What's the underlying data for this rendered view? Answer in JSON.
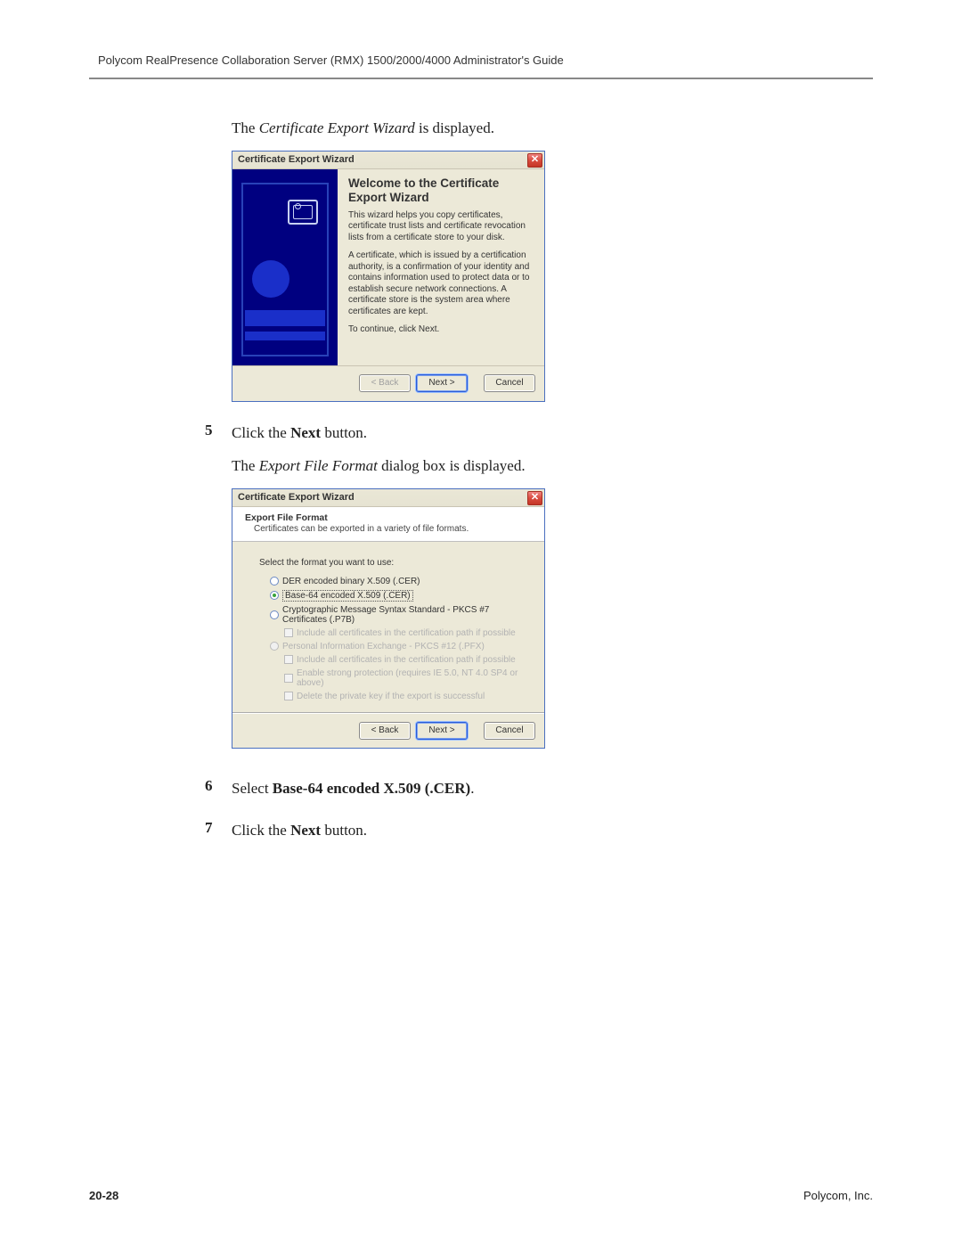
{
  "doc_header": "Polycom RealPresence Collaboration Server (RMX) 1500/2000/4000 Administrator's Guide",
  "intro_text_pre": "The ",
  "intro_text_italic": "Certificate Export Wizard",
  "intro_text_post": " is displayed.",
  "dialog1": {
    "title": "Certificate Export Wizard",
    "heading": "Welcome to the Certificate Export Wizard",
    "p1": "This wizard helps you copy certificates, certificate trust lists and certificate revocation lists from a certificate store to your disk.",
    "p2": "A certificate, which is issued by a certification authority, is a confirmation of your identity and contains information used to protect data or to establish secure network connections. A certificate store is the system area where certificates are kept.",
    "p3": "To continue, click Next.",
    "back": "< Back",
    "next": "Next >",
    "cancel": "Cancel"
  },
  "step5_num": "5",
  "step5_pre": "Click the ",
  "step5_bold": "Next",
  "step5_post": " button.",
  "step5b_pre": "The ",
  "step5b_italic": "Export File Format",
  "step5b_post": " dialog box is displayed.",
  "dialog2": {
    "title": "Certificate Export Wizard",
    "header_title": "Export File Format",
    "header_sub": "Certificates can be exported in a variety of file formats.",
    "prompt": "Select the format you want to use:",
    "opt1": "DER encoded binary X.509 (.CER)",
    "opt2": "Base-64 encoded X.509 (.CER)",
    "opt3": "Cryptographic Message Syntax Standard - PKCS #7 Certificates (.P7B)",
    "opt3a": "Include all certificates in the certification path if possible",
    "opt4": "Personal Information Exchange - PKCS #12 (.PFX)",
    "opt4a": "Include all certificates in the certification path if possible",
    "opt4b": "Enable strong protection (requires IE 5.0, NT 4.0 SP4 or above)",
    "opt4c": "Delete the private key if the export is successful",
    "back": "< Back",
    "next": "Next >",
    "cancel": "Cancel"
  },
  "step6_num": "6",
  "step6_pre": "Select ",
  "step6_bold": "Base-64 encoded X.509 (.CER)",
  "step6_post": ".",
  "step7_num": "7",
  "step7_pre": "Click the ",
  "step7_bold": "Next",
  "step7_post": " button.",
  "footer_page": "20-28",
  "footer_company": "Polycom, Inc."
}
